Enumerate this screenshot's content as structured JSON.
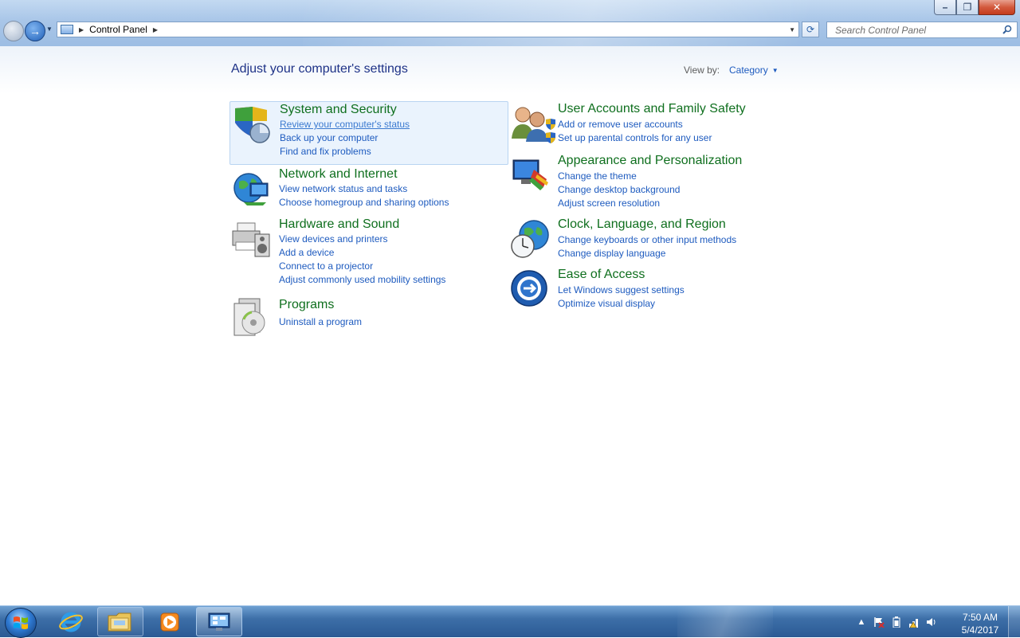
{
  "window": {
    "address": {
      "breadcrumb": "Control Panel"
    },
    "search": {
      "placeholder": "Search Control Panel"
    },
    "buttons": {
      "minimize": "–",
      "maximize": "❐",
      "close": "✕"
    }
  },
  "page": {
    "title": "Adjust your computer's settings",
    "view_by_label": "View by:",
    "view_by_value": "Category"
  },
  "categories": [
    {
      "heading": "System and Security",
      "icon": "shield-icon",
      "links": [
        "Review your computer's status",
        "Back up your computer",
        "Find and fix problems"
      ]
    },
    {
      "heading": "Network and Internet",
      "icon": "network-globe-icon",
      "links": [
        "View network status and tasks",
        "Choose homegroup and sharing options"
      ]
    },
    {
      "heading": "Hardware and Sound",
      "icon": "printer-speaker-icon",
      "links": [
        "View devices and printers",
        "Add a device",
        "Connect to a projector",
        "Adjust commonly used mobility settings"
      ]
    },
    {
      "heading": "Programs",
      "icon": "programs-disc-icon",
      "links": [
        "Uninstall a program"
      ]
    },
    {
      "heading": "User Accounts and Family Safety",
      "icon": "users-icon",
      "links": [
        "Add or remove user accounts",
        "Set up parental controls for any user"
      ]
    },
    {
      "heading": "Appearance and Personalization",
      "icon": "monitor-palette-icon",
      "links": [
        "Change the theme",
        "Change desktop background",
        "Adjust screen resolution"
      ]
    },
    {
      "heading": "Clock, Language, and Region",
      "icon": "clock-globe-icon",
      "links": [
        "Change keyboards or other input methods",
        "Change display language"
      ]
    },
    {
      "heading": "Ease of Access",
      "icon": "ease-of-access-icon",
      "links": [
        "Let Windows suggest settings",
        "Optimize visual display"
      ]
    }
  ],
  "taskbar": {
    "items": [
      "start-orb",
      "internet-explorer-icon",
      "file-explorer-icon",
      "media-player-icon",
      "control-panel-icon"
    ],
    "clock": {
      "time": "7:50 AM",
      "date": "5/4/2017"
    }
  },
  "colors": {
    "heading": "#0f6f1e",
    "link": "#1e5bbf",
    "title": "#1e3287",
    "taskbar": "#2b5a94"
  }
}
